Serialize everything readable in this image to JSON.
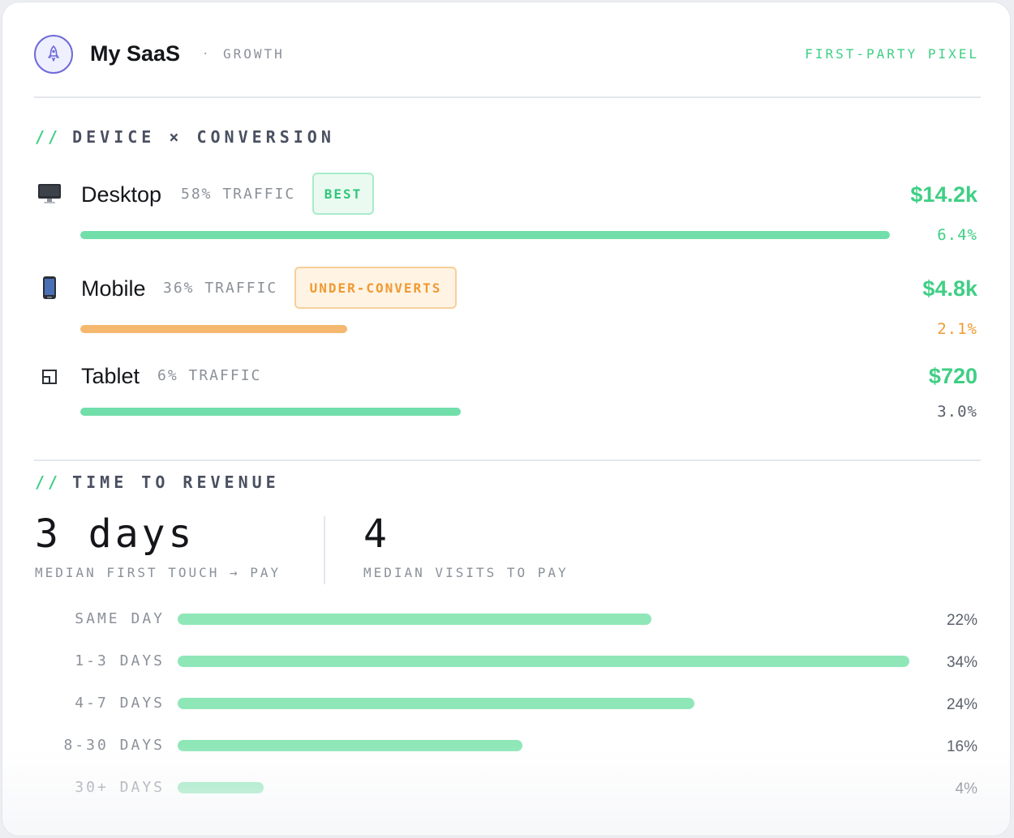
{
  "header": {
    "brand": "My SaaS",
    "separator": "·",
    "section_tag": "GROWTH",
    "source": "FIRST-PARTY PIXEL",
    "logo_icon": "rocket-icon"
  },
  "colors": {
    "accent_green": "#3fcf85",
    "warn_orange": "#ef9a32",
    "bar_green": "#72deaa",
    "bar_orange": "#f4b86e",
    "bucket_green": "#8fe7b8"
  },
  "device_section": {
    "slash": "//",
    "title": "DEVICE × CONVERSION",
    "rows": [
      {
        "icon": "desktop-icon",
        "name": "Desktop",
        "traffic": "58% TRAFFIC",
        "badge": "BEST",
        "badge_kind": "best",
        "revenue": "$14.2k",
        "rate": "6.4%",
        "bar_fraction": 1.0,
        "bar_color": "green",
        "rate_color": "green"
      },
      {
        "icon": "mobile-icon",
        "name": "Mobile",
        "traffic": "36% TRAFFIC",
        "badge": "UNDER-CONVERTS",
        "badge_kind": "under",
        "revenue": "$4.8k",
        "rate": "2.1%",
        "bar_fraction": 0.33,
        "bar_color": "orange",
        "rate_color": "orange"
      },
      {
        "icon": "tablet-icon",
        "name": "Tablet",
        "traffic": "6% TRAFFIC",
        "badge": "",
        "badge_kind": "",
        "revenue": "$720",
        "rate": "3.0%",
        "bar_fraction": 0.47,
        "bar_color": "green",
        "rate_color": "gray"
      }
    ]
  },
  "time_section": {
    "slash": "//",
    "title": "TIME TO REVENUE",
    "stats": [
      {
        "value": "3 days",
        "label": "MEDIAN FIRST TOUCH → PAY"
      },
      {
        "value": "4",
        "label": "MEDIAN VISITS TO PAY"
      }
    ],
    "buckets": [
      {
        "label": "SAME DAY",
        "pct": "22%",
        "fraction": 0.647
      },
      {
        "label": "1-3 DAYS",
        "pct": "34%",
        "fraction": 1.0
      },
      {
        "label": "4-7 DAYS",
        "pct": "24%",
        "fraction": 0.706
      },
      {
        "label": "8-30 DAYS",
        "pct": "16%",
        "fraction": 0.471
      },
      {
        "label": "30+ DAYS",
        "pct": "4%",
        "fraction": 0.118
      }
    ]
  }
}
